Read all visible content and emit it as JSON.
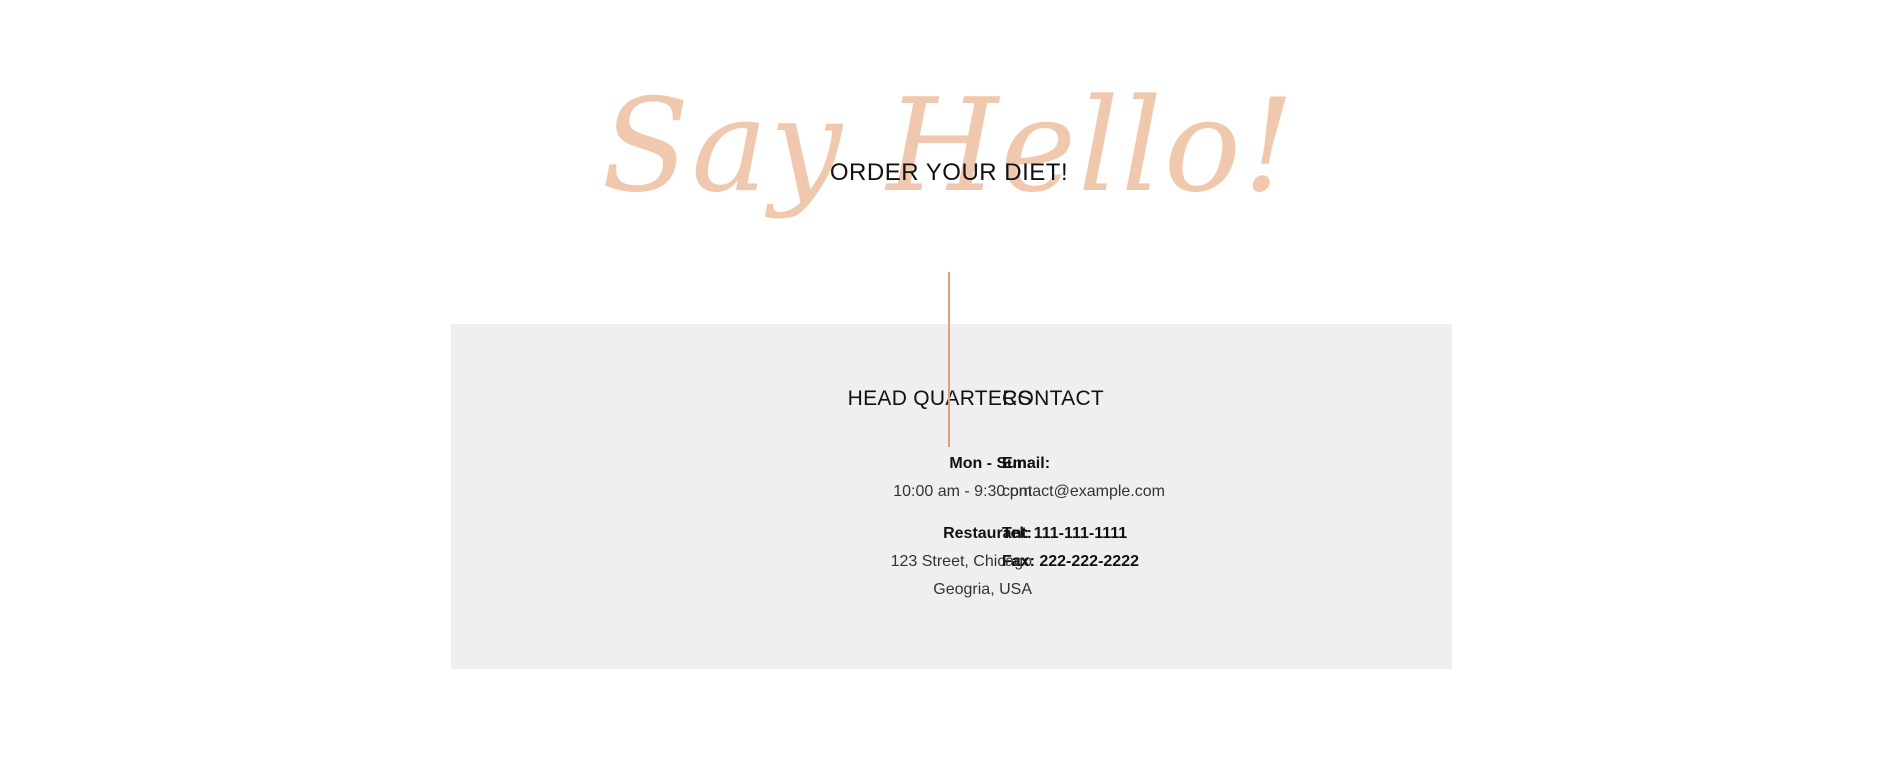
{
  "hero": {
    "script_title": "Say Hello!",
    "subtitle": "ORDER YOUR DIET!"
  },
  "colors": {
    "accent": "#f0c8ad",
    "divider": "#d9a27e",
    "panel_bg": "#efefef"
  },
  "headquarters": {
    "heading": "HEAD QUARTERS",
    "hours_label": "Mon - Sun:",
    "hours_value": "10:00 am - 9:30 pm",
    "restaurant_label": "Restaurant:",
    "address_line1": "123 Street, Chicago",
    "address_line2": "Geogria, USA"
  },
  "contact": {
    "heading": "CONTACT",
    "email_label": "Email:",
    "email_value": "contact@example.com",
    "tel_label": "Tel:",
    "tel_value": "111-111-1111",
    "fax_label": "Fax:",
    "fax_value": "222-222-2222"
  }
}
